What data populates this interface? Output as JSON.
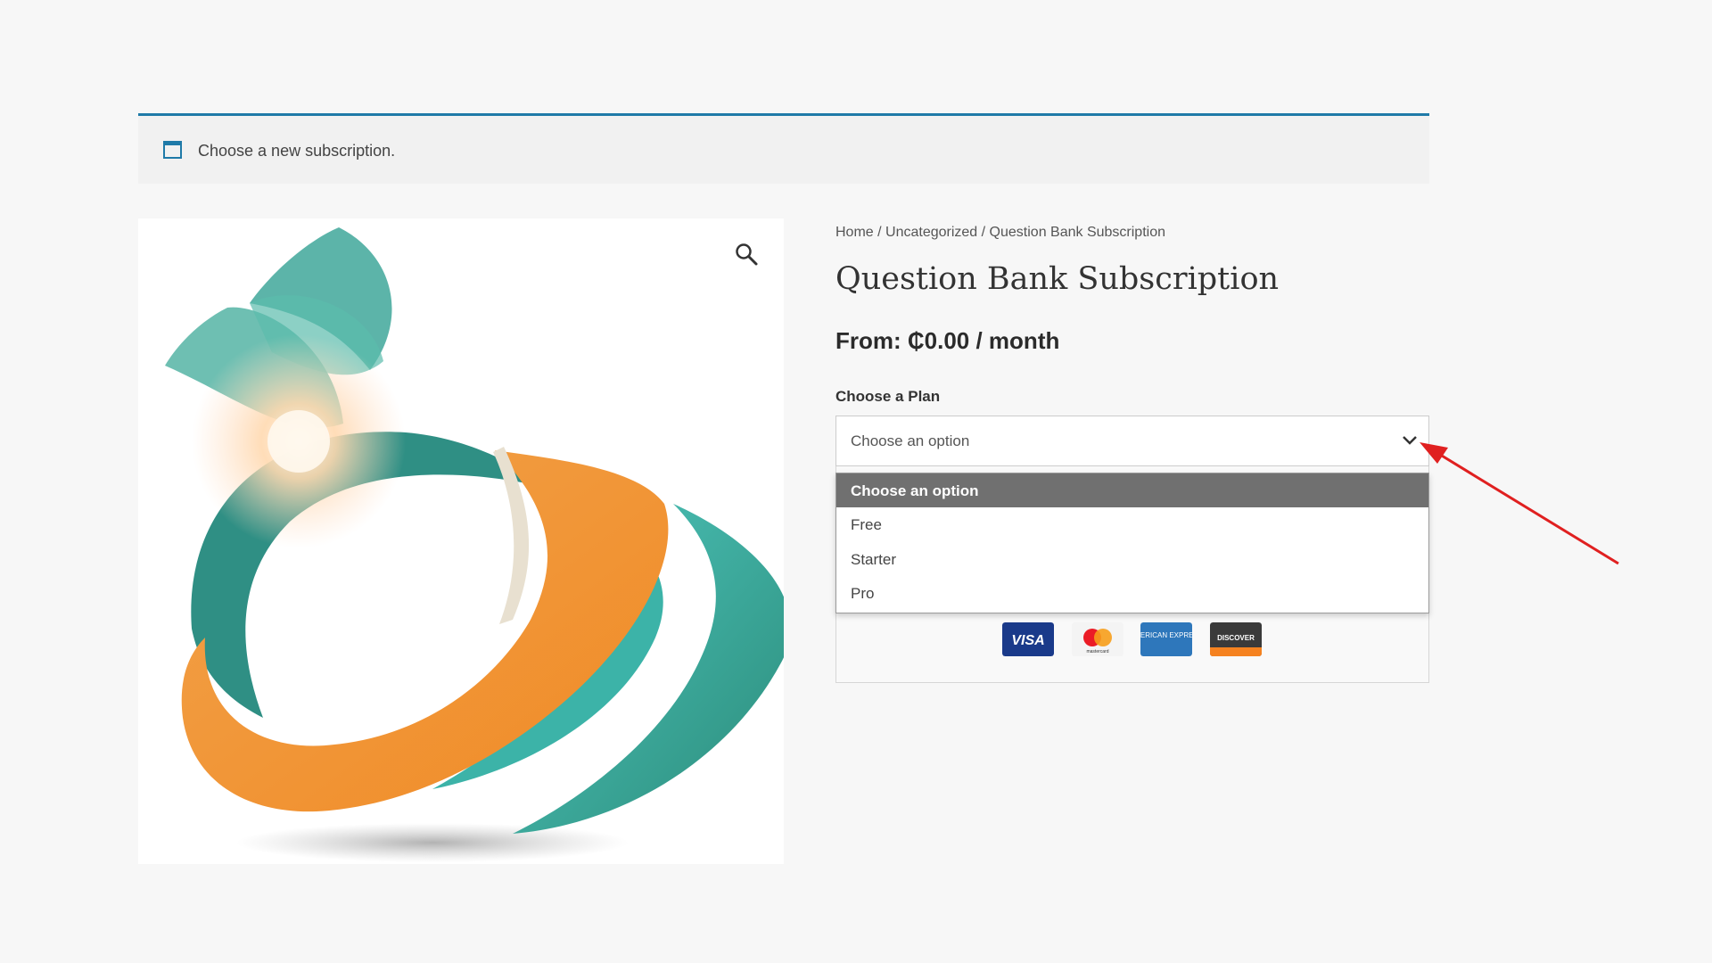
{
  "notice": {
    "message": "Choose a new subscription.",
    "icon": "window-icon",
    "accent_color": "#1f7aa8"
  },
  "gallery": {
    "image": "company-logo",
    "zoom_icon": "magnifier-icon"
  },
  "breadcrumb": {
    "items": [
      "Home",
      "Uncategorized",
      "Question Bank Subscription"
    ],
    "separator": " / "
  },
  "product": {
    "title": "Question Bank Subscription",
    "price": "From: ₵0.00 / month"
  },
  "plan": {
    "label": "Choose a Plan",
    "selected": "Choose an option",
    "options": [
      "Choose an option",
      "Free",
      "Starter",
      "Pro"
    ]
  },
  "payment": {
    "cards": [
      "VISA",
      "mastercard",
      "AMERICAN EXPRESS",
      "DISCOVER"
    ]
  },
  "annotation": {
    "arrow_color": "#e02020"
  }
}
